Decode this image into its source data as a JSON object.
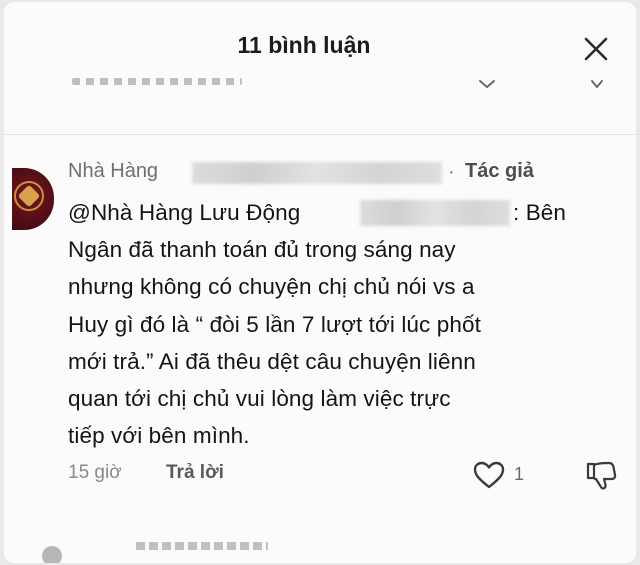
{
  "header": {
    "title": "11 bình luận"
  },
  "comment": {
    "author_name": "Nhà Hàng",
    "separator": "·",
    "author_badge": "Tác giả",
    "body_lines": [
      "@Nhà Hàng Lưu Động",
      "Ngân đã thanh toán đủ trong sáng nay",
      "nhưng không có chuyện chị chủ nói vs a",
      "Huy gì đó là “ đòi 5 lần 7 lượt tới lúc phốt",
      "mới trả.” Ai đã thêu dệt câu chuyện liênn",
      "quan tới chị chủ vui lòng làm việc trực",
      "tiếp với bên mình."
    ],
    "body_line1_tail": ": Bên",
    "time": "15 giờ",
    "reply_label": "Trả lời",
    "like_count": "1"
  },
  "icons": {
    "close": "close-icon",
    "like": "heart-icon",
    "dislike": "thumbs-down-icon"
  }
}
